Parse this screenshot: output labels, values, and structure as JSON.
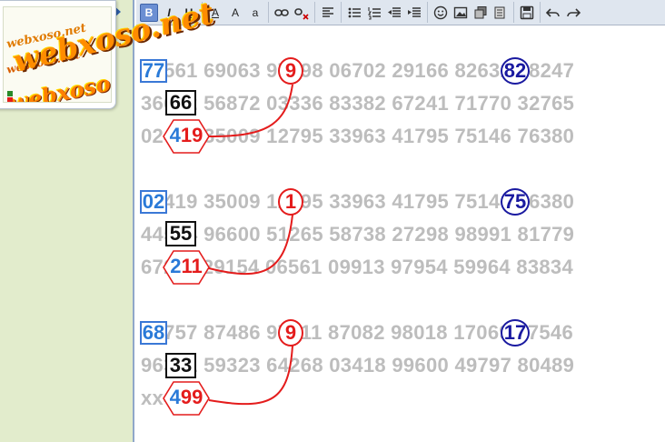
{
  "watermark": "webxoso.net",
  "logo": {
    "line1": "webxoso.net",
    "line2": "webxoso.net",
    "line3": "webxoso.net"
  },
  "toolbar": {
    "buttons": [
      {
        "name": "bold-button",
        "glyph": "B",
        "active": true
      },
      {
        "name": "italic-button",
        "glyph": "I"
      },
      {
        "name": "underline-button",
        "glyph": "U"
      },
      {
        "name": "font-color-button",
        "glyph": "A"
      },
      {
        "name": "font-size-button",
        "glyph": "A"
      },
      {
        "name": "font-face-button",
        "glyph": "a"
      }
    ]
  },
  "blocks": [
    {
      "rows": [
        "77561 69063 97298 06702 29166 82632 08247",
        "36622 56872 03336 83382 67241 71770 32765",
        "02419 35009 12795 33963 41795 75146 76380"
      ],
      "blue_box": "77",
      "black_box": "66",
      "red_circle": "9",
      "navy_circle": "82",
      "hex": {
        "d1": "4",
        "d2": "19"
      }
    },
    {
      "rows": [
        "02419 35009 12795 33963 41795 75146 76380",
        "44554 96600 51265 58738 27298 98991 81779",
        "67211 29154 06561 09913 97954 59964 83834"
      ],
      "blue_box": "02",
      "black_box": "55",
      "red_circle": "1",
      "navy_circle": "75",
      "hex": {
        "d1": "2",
        "d2": "11"
      }
    },
    {
      "rows": [
        "68757 87486 97711 87082 98018 17069 37546",
        "96331 59323 64268 03418 99600 49797 80489",
        "xx499"
      ],
      "blue_box": "68",
      "black_box": "33",
      "red_circle": "9",
      "navy_circle": "17",
      "hex": {
        "d1": "4",
        "d2": "99"
      }
    }
  ]
}
